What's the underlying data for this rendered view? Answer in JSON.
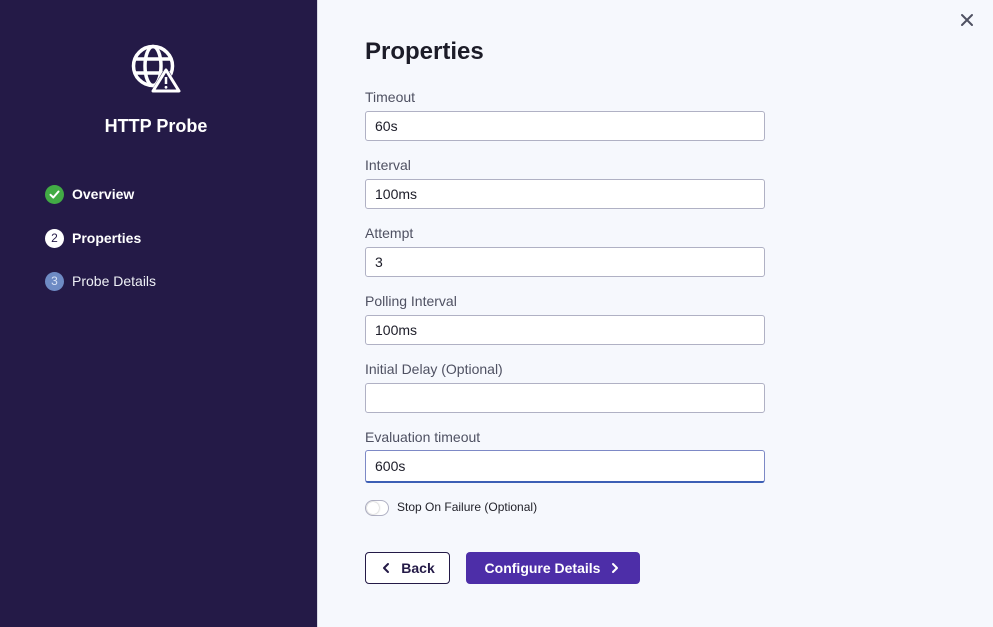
{
  "sidebar": {
    "title": "HTTP Probe",
    "icon": "globe-warning-icon",
    "steps": [
      {
        "number": "",
        "label": "Overview",
        "state": "done"
      },
      {
        "number": "2",
        "label": "Properties",
        "state": "current"
      },
      {
        "number": "3",
        "label": "Probe Details",
        "state": "pending"
      }
    ]
  },
  "main": {
    "title": "Properties",
    "fields": [
      {
        "label": "Timeout",
        "value": "60s"
      },
      {
        "label": "Interval",
        "value": "100ms"
      },
      {
        "label": "Attempt",
        "value": "3"
      },
      {
        "label": "Polling Interval",
        "value": "100ms"
      },
      {
        "label": "Initial Delay (Optional)",
        "value": ""
      },
      {
        "label": "Evaluation timeout",
        "value": "600s"
      }
    ],
    "toggle": {
      "label": "Stop On Failure (Optional)",
      "checked": false
    },
    "buttons": {
      "back": "Back",
      "next": "Configure Details"
    }
  },
  "colors": {
    "sidebar_bg": "#241a47",
    "accent": "#4d2ea8",
    "done_green": "#42ab45"
  }
}
